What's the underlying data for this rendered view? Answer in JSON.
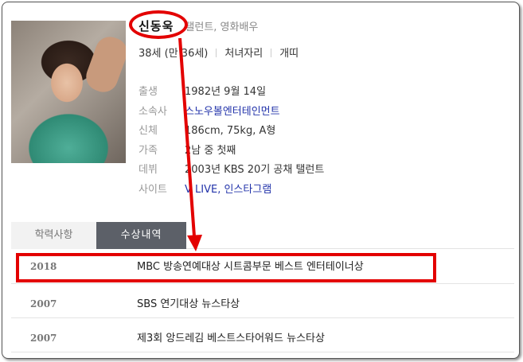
{
  "profile": {
    "name": "신동욱",
    "job": "탤런트, 영화배우",
    "age": "38세 (만 36세)",
    "zodiac": "처녀자리",
    "chinese_zodiac": "개띠"
  },
  "info": [
    {
      "key": "출생",
      "value": "1982년 9월 14일",
      "link": false
    },
    {
      "key": "소속사",
      "value": "스노우볼엔터테인먼트",
      "link": true
    },
    {
      "key": "신체",
      "value": "186cm, 75kg, A형",
      "link": false
    },
    {
      "key": "가족",
      "value": "2남 중 첫째",
      "link": false
    },
    {
      "key": "데뷔",
      "value": "2003년 KBS 20기 공채 탤런트",
      "link": false
    },
    {
      "key": "사이트",
      "value": "V LIVE, 인스타그램",
      "link": true
    }
  ],
  "tabs": [
    {
      "label": "학력사항",
      "active": false
    },
    {
      "label": "수상내역",
      "active": true
    }
  ],
  "awards": [
    {
      "year": "2018",
      "title": "MBC 방송연예대상 시트콤부문 베스트 엔터테이너상"
    },
    {
      "year": "2007",
      "title": "SBS 연기대상 뉴스타상"
    },
    {
      "year": "2007",
      "title": "제3회 앙드레김 베스트스타어워드 뉴스타상"
    }
  ],
  "annotation_color": "#e30000"
}
